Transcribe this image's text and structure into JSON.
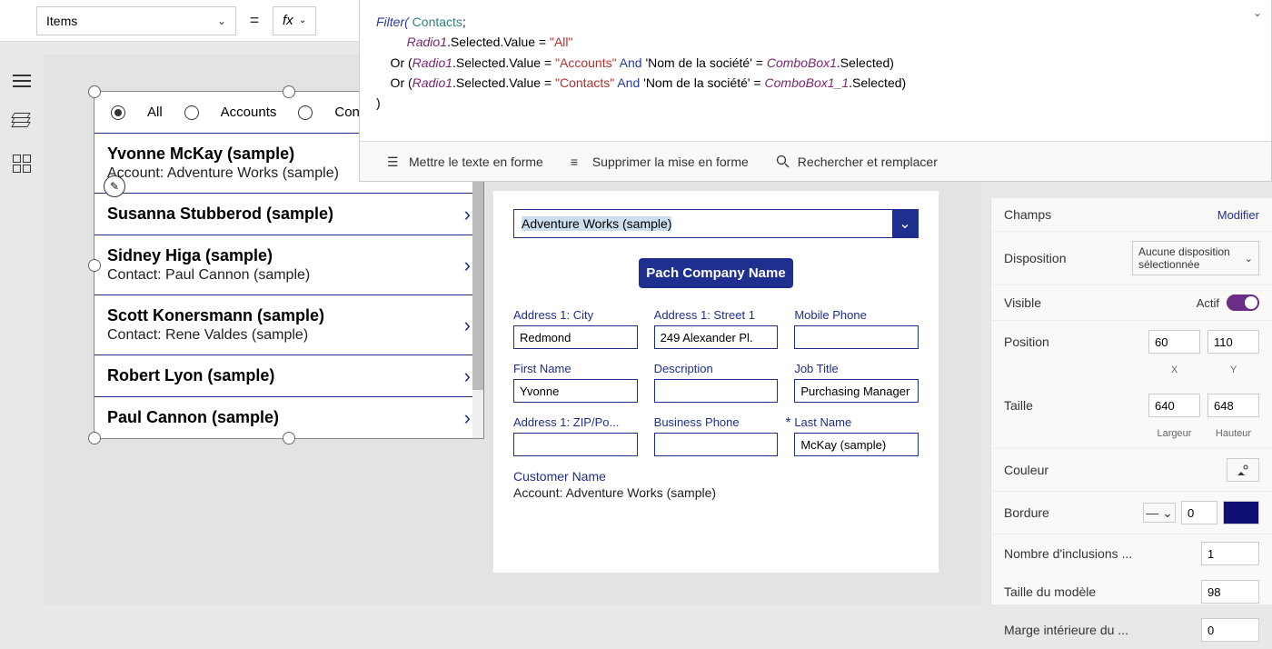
{
  "topbar": {
    "property": "Items",
    "fx": "fx"
  },
  "formula": {
    "line1_pre": "Filter( ",
    "line1_tbl": "Contacts",
    "line1_post": ";",
    "line2_ctrl": "Radio1",
    "line2_mid": ".Selected.Value = ",
    "line2_str": "\"All\"",
    "line3_pre": "    Or (",
    "line3_ctrl": "Radio1",
    "line3_mid": ".Selected.Value = ",
    "line3_str": "\"Accounts\"",
    "line3_kw": " And ",
    "line3_fld": "'Nom de la société'",
    "line3_eq": " = ",
    "line3_ctrl2": "ComboBox1",
    "line3_post": ".Selected)",
    "line4_pre": "    Or (",
    "line4_ctrl": "Radio1",
    "line4_mid": ".Selected.Value = ",
    "line4_str": "\"Contacts\"",
    "line4_kw": " And ",
    "line4_fld": "'Nom de la société'",
    "line4_eq": " = ",
    "line4_ctrl2": "ComboBox1_1",
    "line4_post": ".Selected)",
    "line5": ")"
  },
  "ftoolbar": {
    "format": "Mettre le texte en forme",
    "remove": "Supprimer la mise en forme",
    "find": "Rechercher et remplacer"
  },
  "radios": {
    "all": "All",
    "accounts": "Accounts",
    "contacts": "Contacts"
  },
  "list": [
    {
      "title": "Yvonne McKay (sample)",
      "sub": "Account: Adventure Works (sample)"
    },
    {
      "title": "Susanna Stubberod (sample)",
      "sub": ""
    },
    {
      "title": "Sidney Higa (sample)",
      "sub": "Contact: Paul Cannon (sample)"
    },
    {
      "title": "Scott Konersmann (sample)",
      "sub": "Contact: Rene Valdes (sample)"
    },
    {
      "title": "Robert Lyon (sample)",
      "sub": ""
    },
    {
      "title": "Paul Cannon (sample)",
      "sub": ""
    }
  ],
  "form": {
    "combo": "Adventure Works (sample)",
    "button": "Pach Company Name",
    "fields": {
      "city_l": "Address 1: City",
      "city_v": "Redmond",
      "street_l": "Address 1: Street 1",
      "street_v": "249 Alexander Pl.",
      "mobile_l": "Mobile Phone",
      "mobile_v": "",
      "fname_l": "First Name",
      "fname_v": "Yvonne",
      "desc_l": "Description",
      "desc_v": "",
      "job_l": "Job Title",
      "job_v": "Purchasing Manager",
      "zip_l": "Address 1: ZIP/Po...",
      "zip_v": "",
      "bphone_l": "Business Phone",
      "bphone_v": "",
      "lname_l": "Last Name",
      "lname_v": "McKay (sample)"
    },
    "cust_l": "Customer Name",
    "cust_v": "Account: Adventure Works (sample)"
  },
  "props": {
    "champs": "Champs",
    "modifier": "Modifier",
    "disposition": "Disposition",
    "disposition_val": "Aucune disposition sélectionnée",
    "visible": "Visible",
    "actif": "Actif",
    "position": "Position",
    "pos_x": "60",
    "pos_y": "110",
    "xlbl": "X",
    "ylbl": "Y",
    "taille": "Taille",
    "w": "640",
    "h": "648",
    "wlbl": "Largeur",
    "hlbl": "Hauteur",
    "couleur": "Couleur",
    "bordure": "Bordure",
    "bordure_v": "0",
    "incl": "Nombre d'inclusions ...",
    "incl_v": "1",
    "tmod": "Taille du modèle",
    "tmod_v": "98",
    "marg": "Marge intérieure du ...",
    "marg_v": "0"
  }
}
